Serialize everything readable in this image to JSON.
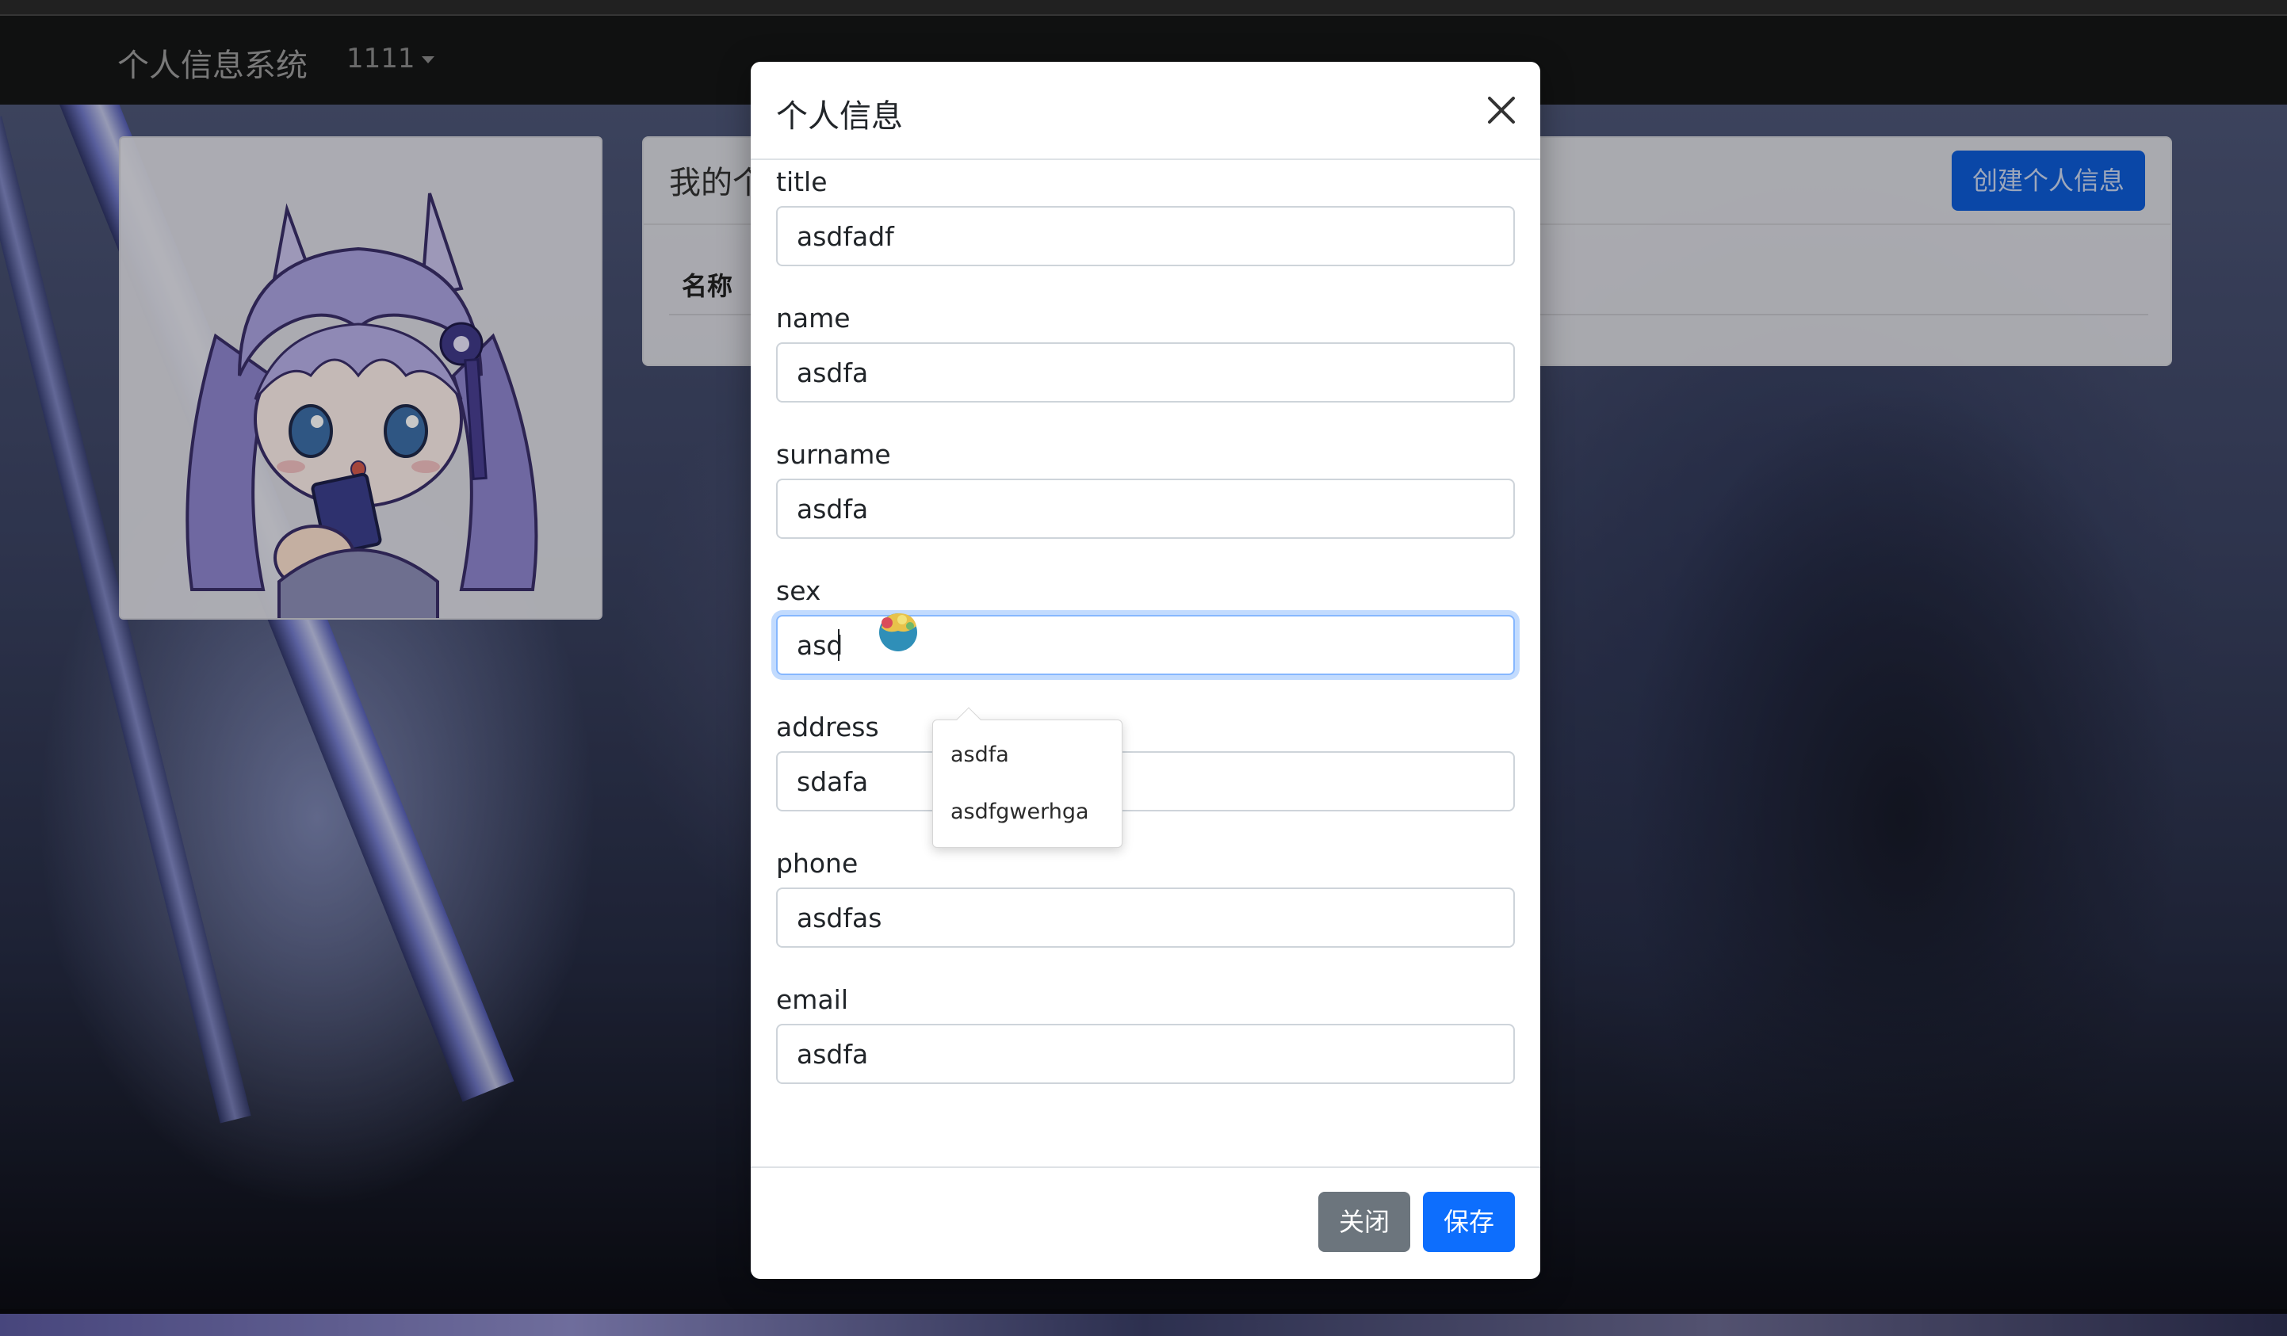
{
  "navbar": {
    "brand": "个人信息系统",
    "user": "1111"
  },
  "background": {
    "avatar_alt": "anime-chibi-avatar"
  },
  "list_panel": {
    "title": "我的个",
    "create_button": "创建个人信息",
    "column_name": "名称"
  },
  "modal": {
    "title": "个人信息",
    "fields": [
      {
        "label": "title",
        "value": "asdfadf"
      },
      {
        "label": "name",
        "value": "asdfa"
      },
      {
        "label": "surname",
        "value": "asdfa"
      },
      {
        "label": "sex",
        "value": "asd"
      },
      {
        "label": "address",
        "value": "sdafa"
      },
      {
        "label": "phone",
        "value": "asdfas"
      },
      {
        "label": "email",
        "value": "asdfa"
      }
    ],
    "close_button": "关闭",
    "save_button": "保存"
  },
  "autocomplete": {
    "items": [
      "asdfa",
      "asdfgwerhga"
    ]
  },
  "colors": {
    "primary": "#0d6efd",
    "secondary": "#6c757d",
    "focus_ring": "#86b7fe",
    "navbar": "#151617"
  },
  "icons": [
    "close-icon",
    "caret-down-icon",
    "cursor-badge-icon"
  ]
}
